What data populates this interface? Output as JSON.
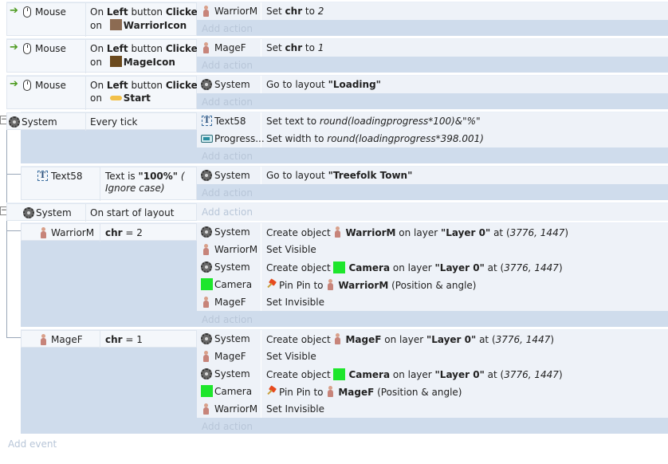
{
  "events": [
    {
      "object": "Mouse",
      "cond_prefix": "On ",
      "cond_button": "Left",
      "cond_mid": " button ",
      "cond_clicked": "Clicked",
      "cond_on": "on",
      "cond_target": "WarriorIcon",
      "actions": [
        {
          "object": "WarriorM",
          "text_prefix": "Set ",
          "bold": "chr",
          "text_mid": " to ",
          "italic": "2"
        }
      ],
      "add_action": "Add action"
    },
    {
      "object": "Mouse",
      "cond_prefix": "On ",
      "cond_button": "Left",
      "cond_mid": " button ",
      "cond_clicked": "Clicked",
      "cond_on": "on",
      "cond_target": "MageIcon",
      "actions": [
        {
          "object": "MageF",
          "text_prefix": "Set ",
          "bold": "chr",
          "text_mid": " to ",
          "italic": "1"
        }
      ],
      "add_action": "Add action"
    },
    {
      "object": "Mouse",
      "cond_prefix": "On ",
      "cond_button": "Left",
      "cond_mid": " button ",
      "cond_clicked": "Clicked",
      "cond_on": "on",
      "cond_target": "Start",
      "actions": [
        {
          "object": "System",
          "text_prefix": "Go to layout ",
          "bold": "\"Loading\""
        }
      ],
      "add_action": "Add action"
    },
    {
      "object": "System",
      "cond": "Every tick",
      "actions": [
        {
          "object": "Text58",
          "text_prefix": "Set text to ",
          "italic": "round(loadingprogress*100)&\"%\""
        },
        {
          "object": "Progress...",
          "text_prefix": "Set width to ",
          "italic": "round(loadingprogress*398.001)"
        }
      ],
      "add_action": "Add action"
    },
    {
      "object": "Text58",
      "cond_prefix": "Text is ",
      "cond_bold": "\"100%\"",
      "cond_italic": " ( Ignore case)",
      "actions": [
        {
          "object": "System",
          "text_prefix": "Go to layout ",
          "bold": "\"Treefolk Town\""
        }
      ],
      "add_action": "Add action"
    },
    {
      "object": "System",
      "cond": "On start of layout",
      "add_action": "Add action"
    },
    {
      "object": "WarriorM",
      "cond_bold": "chr",
      "cond_rest": " = 2",
      "actions": [
        {
          "object": "System",
          "text_prefix": "Create object ",
          "obj": "WarriorM",
          "layer_prefix": " on layer ",
          "layer": "\"Layer 0\"",
          "at": " at (",
          "coords": "3776, 1447",
          ")": ")"
        },
        {
          "object": "WarriorM",
          "text_prefix": "Set Visible"
        },
        {
          "object": "System",
          "text_prefix": "Create object ",
          "obj": "Camera",
          "layer_prefix": " on layer ",
          "layer": "\"Layer 0\"",
          "at": " at (",
          "coords": "3776, 1447",
          ")": ")"
        },
        {
          "object": "Camera",
          "pin": "Pin Pin to ",
          "obj": "WarriorM",
          "suffix": " (Position & angle)"
        },
        {
          "object": "MageF",
          "text_prefix": "Set Invisible"
        }
      ],
      "add_action": "Add action"
    },
    {
      "object": "MageF",
      "cond_bold": "chr",
      "cond_rest": " = 1",
      "actions": [
        {
          "object": "System",
          "text_prefix": "Create object ",
          "obj": "MageF",
          "layer_prefix": " on layer ",
          "layer": "\"Layer 0\"",
          "at": " at (",
          "coords": "3776, 1447",
          ")": ")"
        },
        {
          "object": "MageF",
          "text_prefix": "Set Visible"
        },
        {
          "object": "System",
          "text_prefix": "Create object ",
          "obj": "Camera",
          "layer_prefix": " on layer ",
          "layer": "\"Layer 0\"",
          "at": " at (",
          "coords": "3776, 1447",
          ")": ")"
        },
        {
          "object": "Camera",
          "pin": "Pin Pin to ",
          "obj": "MageF",
          "suffix": " (Position & angle)"
        },
        {
          "object": "WarriorM",
          "text_prefix": "Set Invisible"
        }
      ],
      "add_action": "Add action"
    }
  ],
  "add_event": "Add event",
  "colors": {
    "event_bg": "#cfdcec",
    "action_bg": "#eef2f8",
    "camera": "#1ee62c",
    "add_text": "#b8c6d8"
  },
  "icons": [
    "mouse-icon",
    "gear-icon",
    "sprite-icon",
    "text-icon",
    "progress-bar-icon",
    "pin-icon",
    "green-swatch-icon",
    "run-arrow-icon"
  ]
}
